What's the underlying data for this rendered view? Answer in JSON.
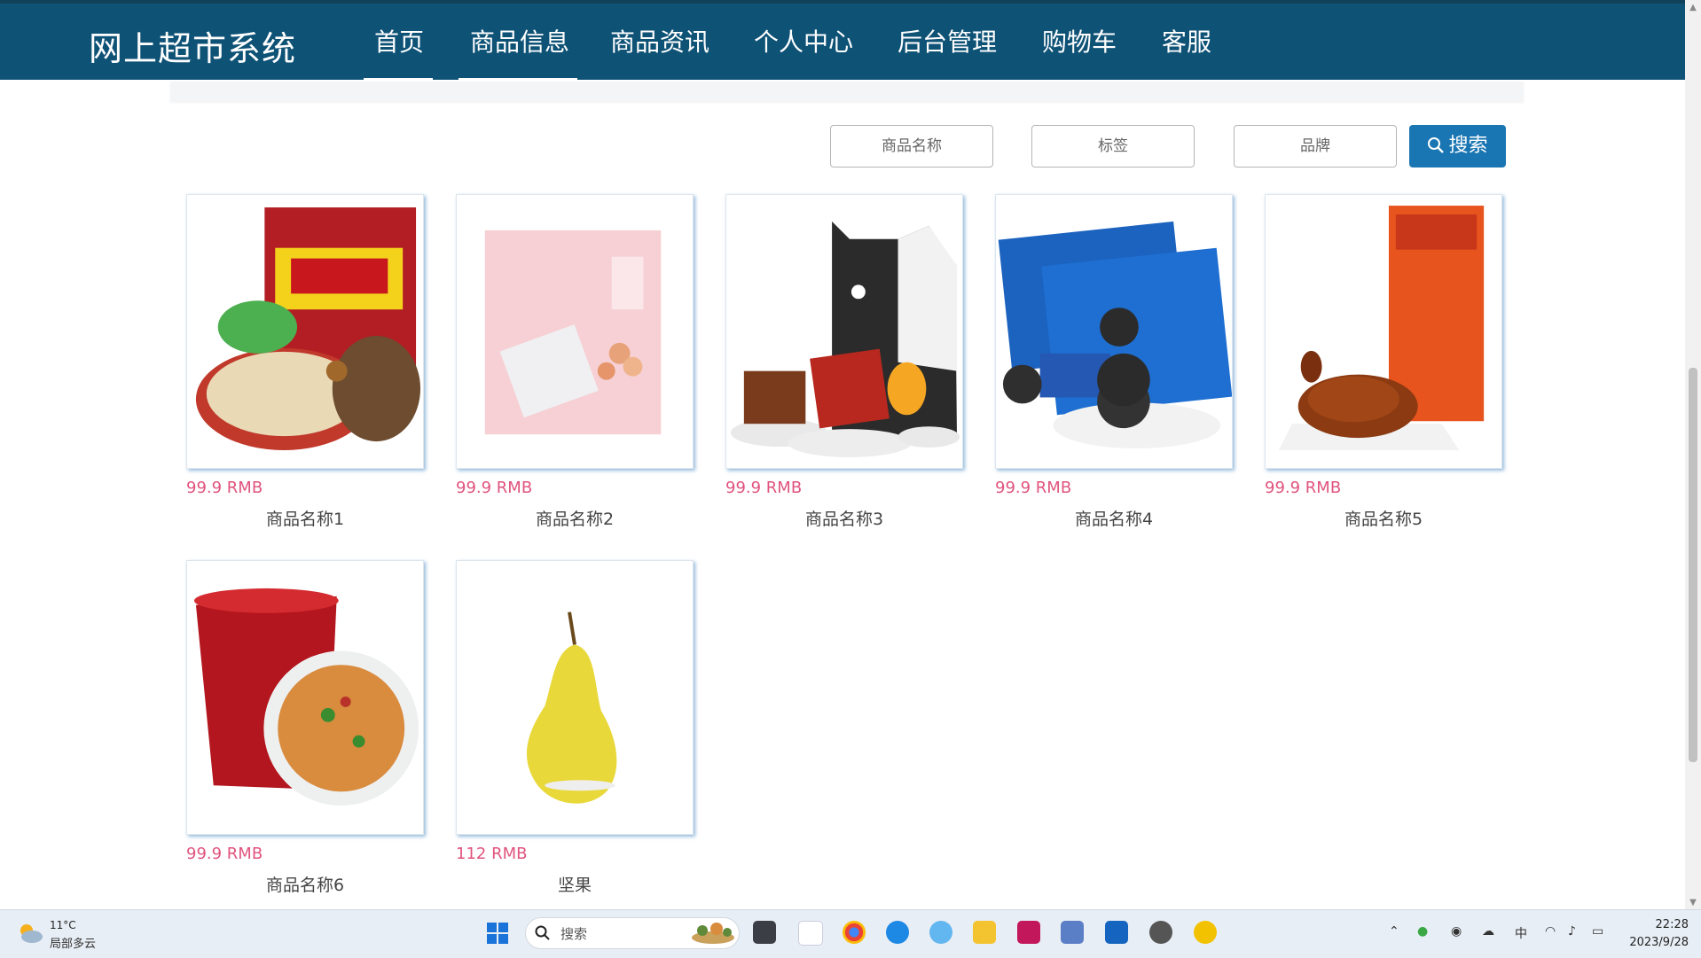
{
  "header": {
    "brand": "网上超市系统",
    "nav": [
      "首页",
      "商品信息",
      "商品资讯",
      "个人中心",
      "后台管理",
      "购物车",
      "客服"
    ]
  },
  "search": {
    "name_placeholder": "商品名称",
    "tag_placeholder": "标签",
    "brand_placeholder": "品牌",
    "button_label": "搜索"
  },
  "products": [
    {
      "price": "99.9 RMB",
      "name": "商品名称1"
    },
    {
      "price": "99.9 RMB",
      "name": "商品名称2"
    },
    {
      "price": "99.9 RMB",
      "name": "商品名称3"
    },
    {
      "price": "99.9 RMB",
      "name": "商品名称4"
    },
    {
      "price": "99.9 RMB",
      "name": "商品名称5"
    },
    {
      "price": "99.9 RMB",
      "name": "商品名称6"
    },
    {
      "price": "112 RMB",
      "name": "坚果"
    }
  ],
  "taskbar": {
    "weather_temp": "11°C",
    "weather_desc": "局部多云",
    "search_label": "搜索",
    "time": "22:28",
    "date": "2023/9/28",
    "ime": "中"
  },
  "colors": {
    "nav_bg": "#0e5276",
    "price": "#e0547e",
    "search_button": "#1a76b3"
  }
}
